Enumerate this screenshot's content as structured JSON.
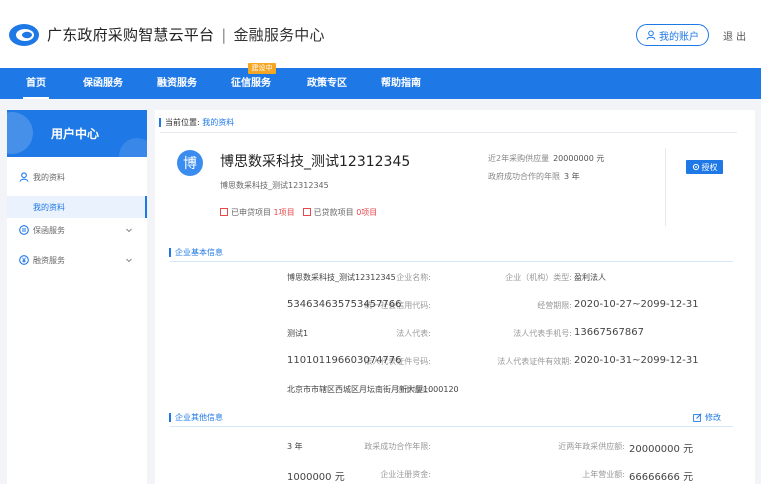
{
  "header": {
    "brand": "广东政府采购智慧云平台",
    "separator": "|",
    "subtitle": "金融服务中心",
    "account_label": "我的账户",
    "logout_label": "退 出"
  },
  "nav": {
    "items": [
      {
        "label": "首页",
        "active": true
      },
      {
        "label": "保函服务"
      },
      {
        "label": "融资服务"
      },
      {
        "label": "征信服务"
      },
      {
        "label": "政策专区"
      },
      {
        "label": "帮助指南"
      }
    ],
    "badge": "建设中"
  },
  "sidebar": {
    "title": "用户中心",
    "items": [
      {
        "label": "我的资料",
        "icon": "user-icon"
      },
      {
        "label": "我的资料",
        "sub": true,
        "active": true
      },
      {
        "label": "保函服务",
        "icon": "shield-icon"
      },
      {
        "label": "融资服务",
        "icon": "yen-icon"
      }
    ]
  },
  "breadcrumb": {
    "prefix": "当前位置:",
    "current": "我的资料"
  },
  "profile": {
    "avatar_char": "博",
    "name": "博思数采科技_测试12312345",
    "sub_name": "博思数采科技_测试12312345",
    "tags": [
      {
        "label": "已申贷项目",
        "value": "1项目"
      },
      {
        "label": "已贷款项目",
        "value": "0项目"
      }
    ],
    "stats": [
      {
        "label": "近2年采购供应量",
        "value": "20000000 元"
      },
      {
        "label": "政府成功合作的年限",
        "value": "3 年"
      }
    ],
    "auth_label": "授权"
  },
  "basic_info": {
    "title": "企业基本信息",
    "fields": [
      {
        "label": "企业名称:",
        "value": "博思数采科技_测试12312345"
      },
      {
        "label": "企业（机构）类型:",
        "value": "盈利法人"
      },
      {
        "label": "统一社会信用代码:",
        "value": "534634635753457766"
      },
      {
        "label": "经营期限:",
        "value": "2020-10-27~2099-12-31"
      },
      {
        "label": "法人代表:",
        "value": "测试1"
      },
      {
        "label": "法人代表手机号:",
        "value": "13667567867"
      },
      {
        "label": "法人代表证件号码:",
        "value": "110101196603074776"
      },
      {
        "label": "法人代表证件有效期:",
        "value": "2020-10-31~2099-12-31"
      },
      {
        "label": "注册地址:",
        "value": "北京市市辖区西城区月坛南街月新大厦1000120"
      }
    ]
  },
  "other_info": {
    "title": "企业其他信息",
    "edit_label": "修改",
    "fields": [
      {
        "label": "政采成功合作年限:",
        "value": "3 年"
      },
      {
        "label": "近两年政采供应额:",
        "value": "20000000 元"
      },
      {
        "label": "企业注册资金:",
        "value": "1000000 元"
      },
      {
        "label": "上年营业额:",
        "value": "66666666 元"
      }
    ]
  },
  "colors": {
    "primary": "#1e78e6",
    "accent_orange": "#f5a623",
    "accent_red": "#e5484d"
  }
}
